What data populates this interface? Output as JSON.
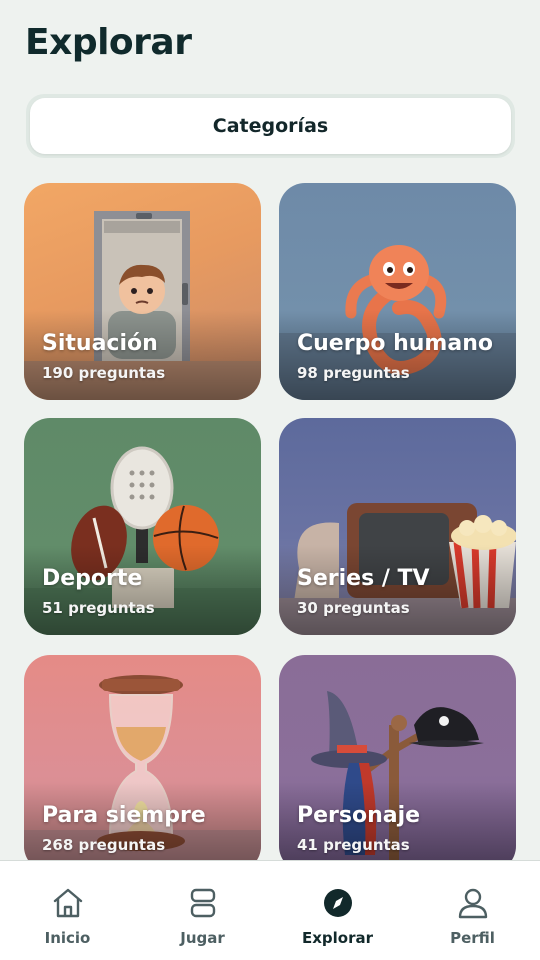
{
  "header": {
    "title": "Explorar"
  },
  "tabs": {
    "active_label": "Categorías"
  },
  "categories": [
    {
      "label": "Situación",
      "count": "190 preguntas"
    },
    {
      "label": "Cuerpo humano",
      "count": "98 preguntas"
    },
    {
      "label": "Deporte",
      "count": "51 preguntas"
    },
    {
      "label": "Series / TV",
      "count": "30 preguntas"
    },
    {
      "label": "Para siempre",
      "count": "268 preguntas"
    },
    {
      "label": "Personaje",
      "count": "41 preguntas"
    }
  ],
  "bottom_nav": {
    "items": [
      {
        "label": "Inicio",
        "icon": "home-icon",
        "active": false
      },
      {
        "label": "Jugar",
        "icon": "cards-icon",
        "active": false
      },
      {
        "label": "Explorar",
        "icon": "compass-icon",
        "active": true
      },
      {
        "label": "Perfil",
        "icon": "user-icon",
        "active": false
      }
    ]
  },
  "colors": {
    "background": "#eef2ef",
    "text": "#13272a",
    "nav_inactive": "#4d5f62"
  }
}
